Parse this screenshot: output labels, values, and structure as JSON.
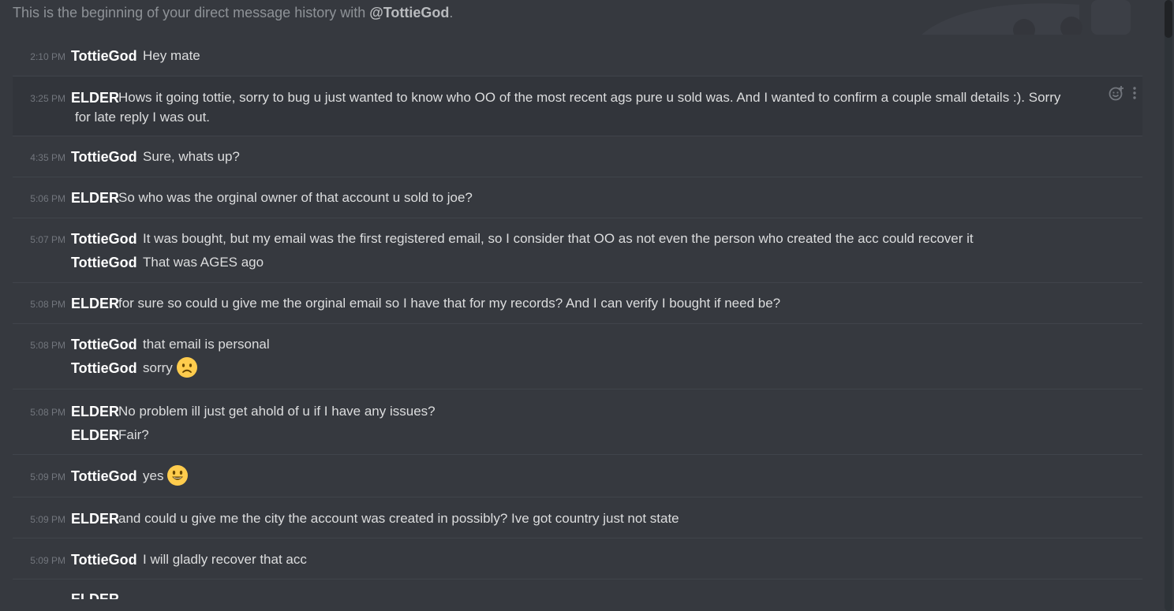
{
  "chat": {
    "beginning_prefix": "This is the beginning of your direct message history with ",
    "beginning_user": "@TottieGod",
    "beginning_suffix": "."
  },
  "messages": [
    {
      "time": "2:10 PM",
      "lines": [
        {
          "author": "TottieGod",
          "text": "Hey mate"
        }
      ]
    },
    {
      "time": "3:25 PM",
      "lines": [
        {
          "author": "ELDER",
          "text": "Hows it going tottie, sorry to bug u just wanted to know who OO of the most recent ags pure u sold was. And I wanted to confirm a couple small details :). Sorry",
          "continuation": "for late reply I was out."
        }
      ]
    },
    {
      "time": "4:35 PM",
      "lines": [
        {
          "author": "TottieGod",
          "text": "Sure, whats up?"
        }
      ]
    },
    {
      "time": "5:06 PM",
      "lines": [
        {
          "author": "ELDER",
          "text": "So who was the orginal owner of that account u sold to joe?"
        }
      ]
    },
    {
      "time": "5:07 PM",
      "lines": [
        {
          "author": "TottieGod",
          "text": "It was bought, but my email was the first registered email, so I consider that OO as not even the person who created the acc could recover it"
        },
        {
          "author": "TottieGod",
          "text": "That was AGES ago"
        }
      ]
    },
    {
      "time": "5:08 PM",
      "lines": [
        {
          "author": "ELDER",
          "text": "for sure so could u give me the orginal email so I have that for my records? And I can verify I bought if need be?"
        }
      ]
    },
    {
      "time": "5:08 PM",
      "lines": [
        {
          "author": "TottieGod",
          "text": "that email is personal"
        },
        {
          "author": "TottieGod",
          "text": "sorry",
          "emoji": "frowning-face"
        }
      ]
    },
    {
      "time": "5:08 PM",
      "lines": [
        {
          "author": "ELDER",
          "text": "No problem ill just get ahold of u if I have any issues?"
        },
        {
          "author": "ELDER",
          "text": "Fair?"
        }
      ]
    },
    {
      "time": "5:09 PM",
      "lines": [
        {
          "author": "TottieGod",
          "text": "yes",
          "emoji": "smiling-face"
        }
      ]
    },
    {
      "time": "5:09 PM",
      "lines": [
        {
          "author": "ELDER",
          "text": "and could u give me the city the account was created in possibly? Ive got country just not state"
        }
      ]
    },
    {
      "time": "5:09 PM",
      "lines": [
        {
          "author": "TottieGod",
          "text": "I will gladly recover that acc"
        }
      ]
    }
  ],
  "partial_last": {
    "author": "ELDER"
  },
  "icons": {
    "add_reaction": "add-reaction-icon",
    "more": "more-options-icon"
  },
  "colors": {
    "background": "#36393f",
    "author": "#ffffff",
    "text": "#dcddde",
    "timestamp": "#72767d",
    "divider": "#40444b"
  }
}
